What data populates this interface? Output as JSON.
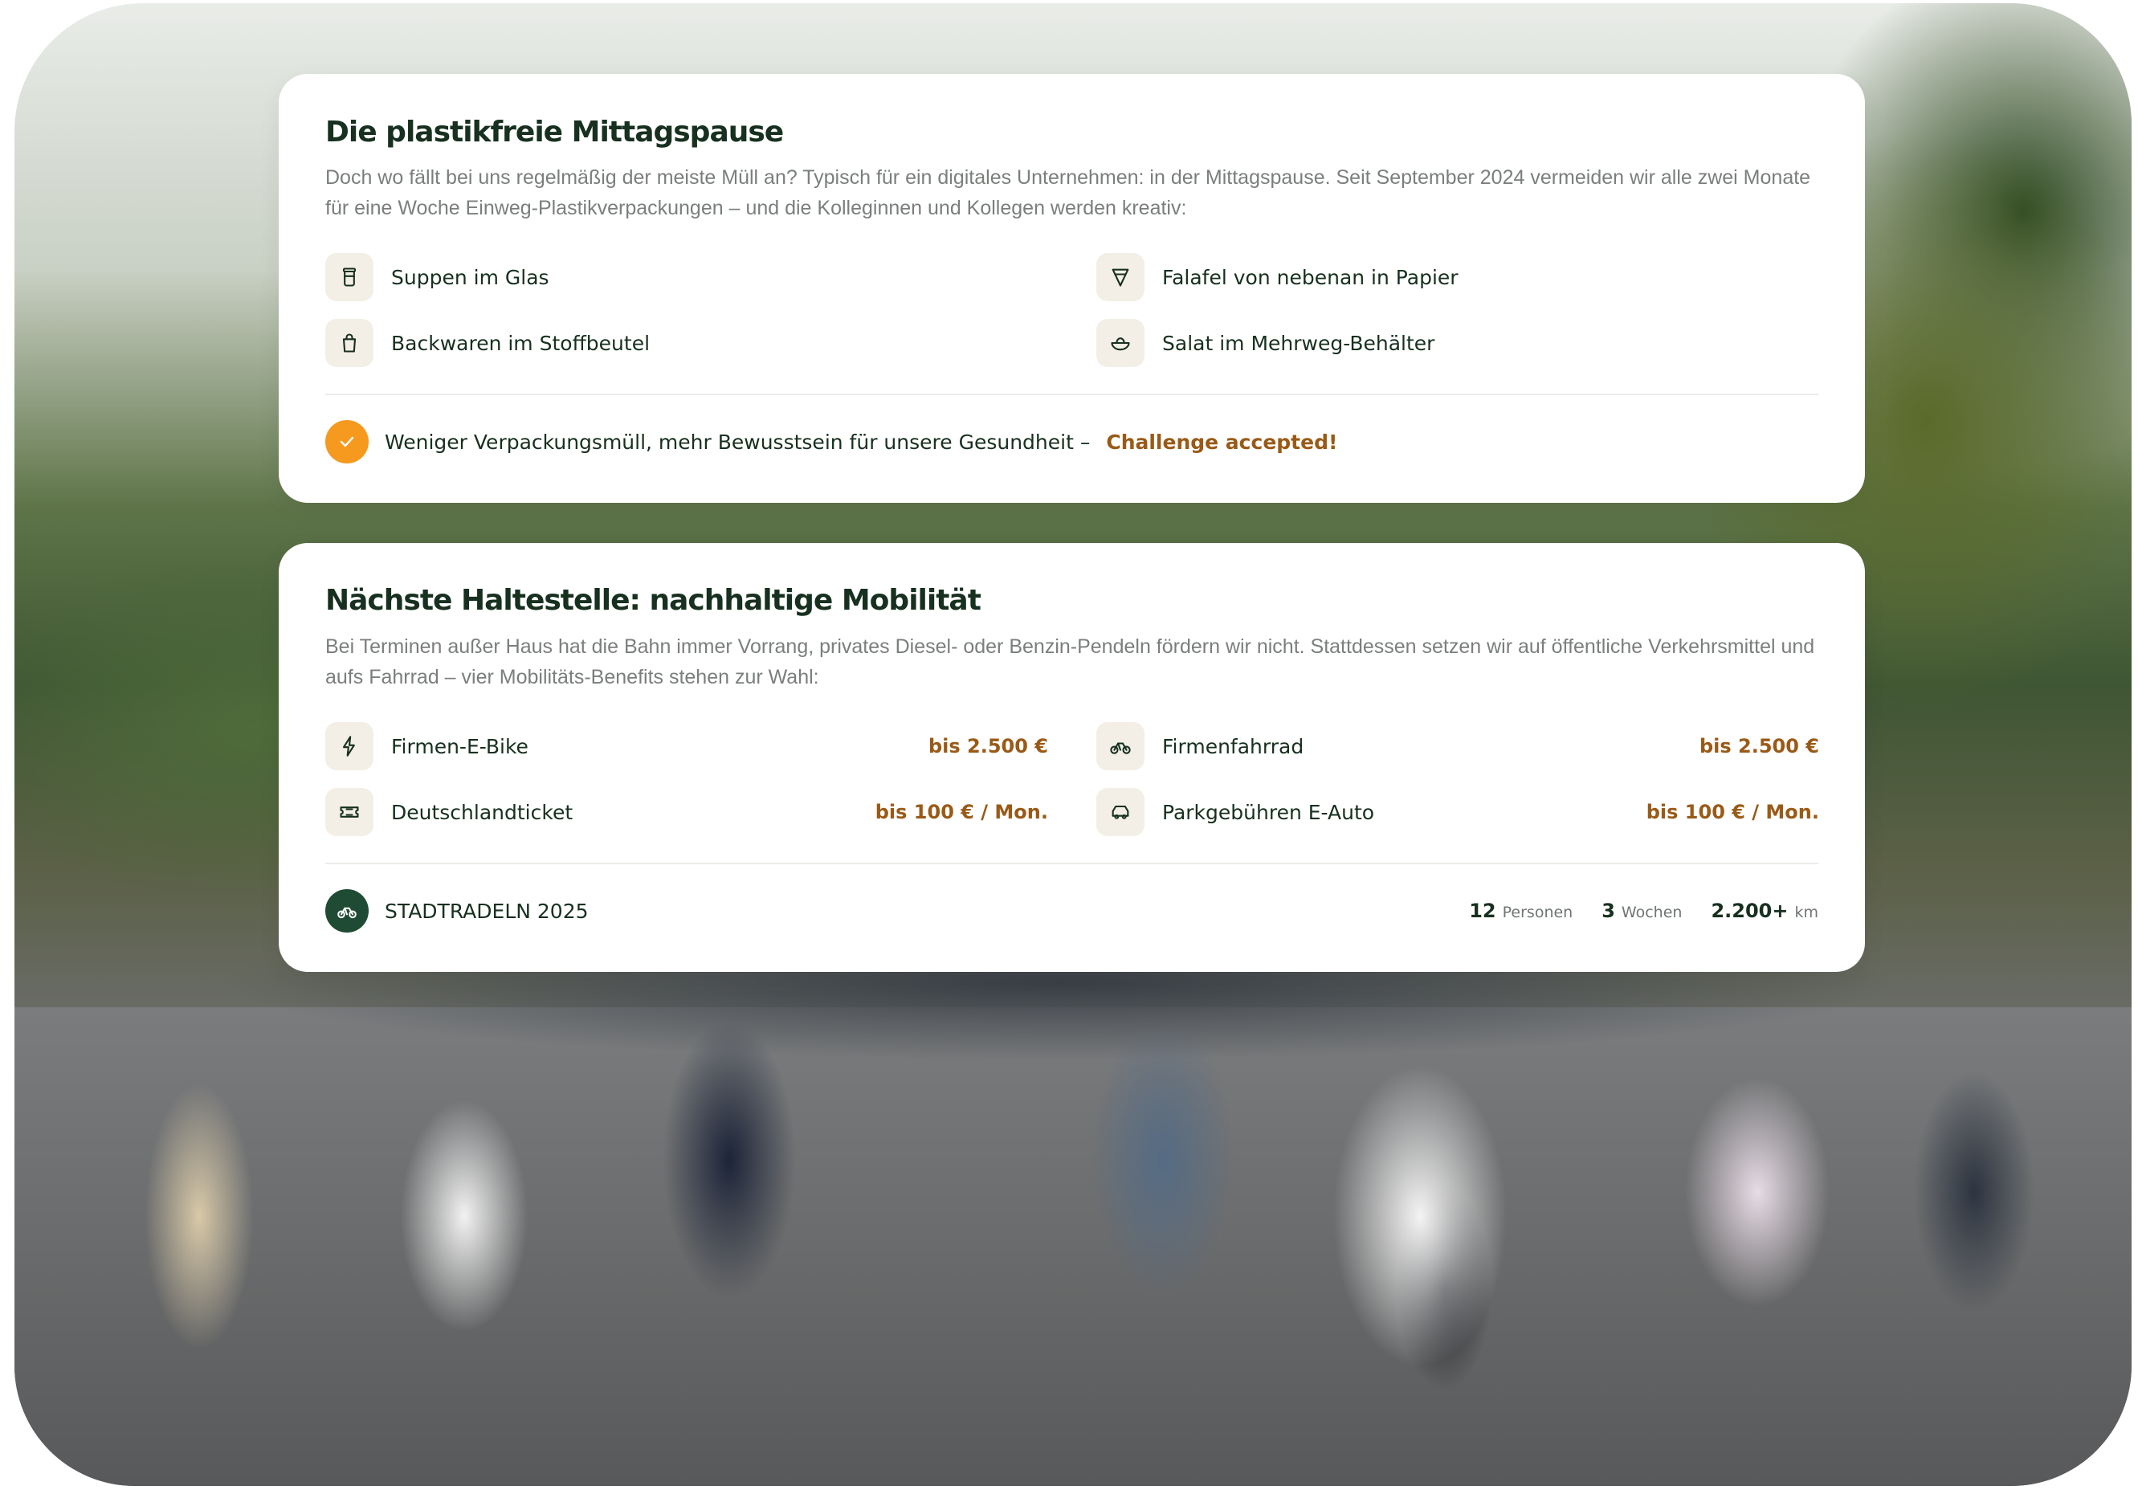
{
  "plastic_section": {
    "title": "Die plastikfreie Mittagspause",
    "description": "Doch wo fällt bei uns regelmäßig der meiste Müll an? Typisch für ein digitales Unternehmen: in der Mittagspause. Seit September 2024 vermeiden wir alle zwei Monate für eine Woche Einweg-Plastikverpackungen – und die Kolleginnen und Kollegen werden kreativ:",
    "items": [
      {
        "label": "Suppen im Glas",
        "icon": "jar-icon"
      },
      {
        "label": "Falafel von nebenan in Papier",
        "icon": "paper-cone-icon"
      },
      {
        "label": "Backwaren im Stoffbeutel",
        "icon": "bag-icon"
      },
      {
        "label": "Salat im Mehrweg-Behälter",
        "icon": "bowl-icon"
      }
    ],
    "footer_text": "Weniger Verpackungsmüll, mehr Bewusstsein für unsere Gesundheit –",
    "footer_accent": "Challenge accepted!"
  },
  "mobility_section": {
    "title": "Nächste Haltestelle: nachhaltige Mobilität",
    "description": "Bei Terminen außer Haus hat die Bahn immer Vorrang, privates Diesel- oder Benzin-Pendeln fördern wir nicht. Stattdessen setzen wir auf öffentliche Verkehrsmittel und aufs Fahrrad – vier Mobilitäts-Benefits stehen zur Wahl:",
    "benefits": [
      {
        "label": "Firmen-E-Bike",
        "price": "bis 2.500 €",
        "icon": "lightning-icon"
      },
      {
        "label": "Firmenfahrrad",
        "price": "bis 2.500 €",
        "icon": "bicycle-icon"
      },
      {
        "label": "Deutschlandticket",
        "price": "bis 100 € / Mon.",
        "icon": "ticket-icon"
      },
      {
        "label": "Parkgebühren E-Auto",
        "price": "bis 100 € / Mon.",
        "icon": "car-icon"
      }
    ],
    "footer_title": "STADTRADELN 2025",
    "stats": [
      {
        "value": "12",
        "unit": "Personen"
      },
      {
        "value": "3",
        "unit": "Wochen"
      },
      {
        "value": "2.200+",
        "unit": "km"
      }
    ]
  },
  "colors": {
    "accent": "#9a5a17",
    "check": "#f59a1e",
    "dark_green": "#1f4a33",
    "text": "#17301f"
  }
}
